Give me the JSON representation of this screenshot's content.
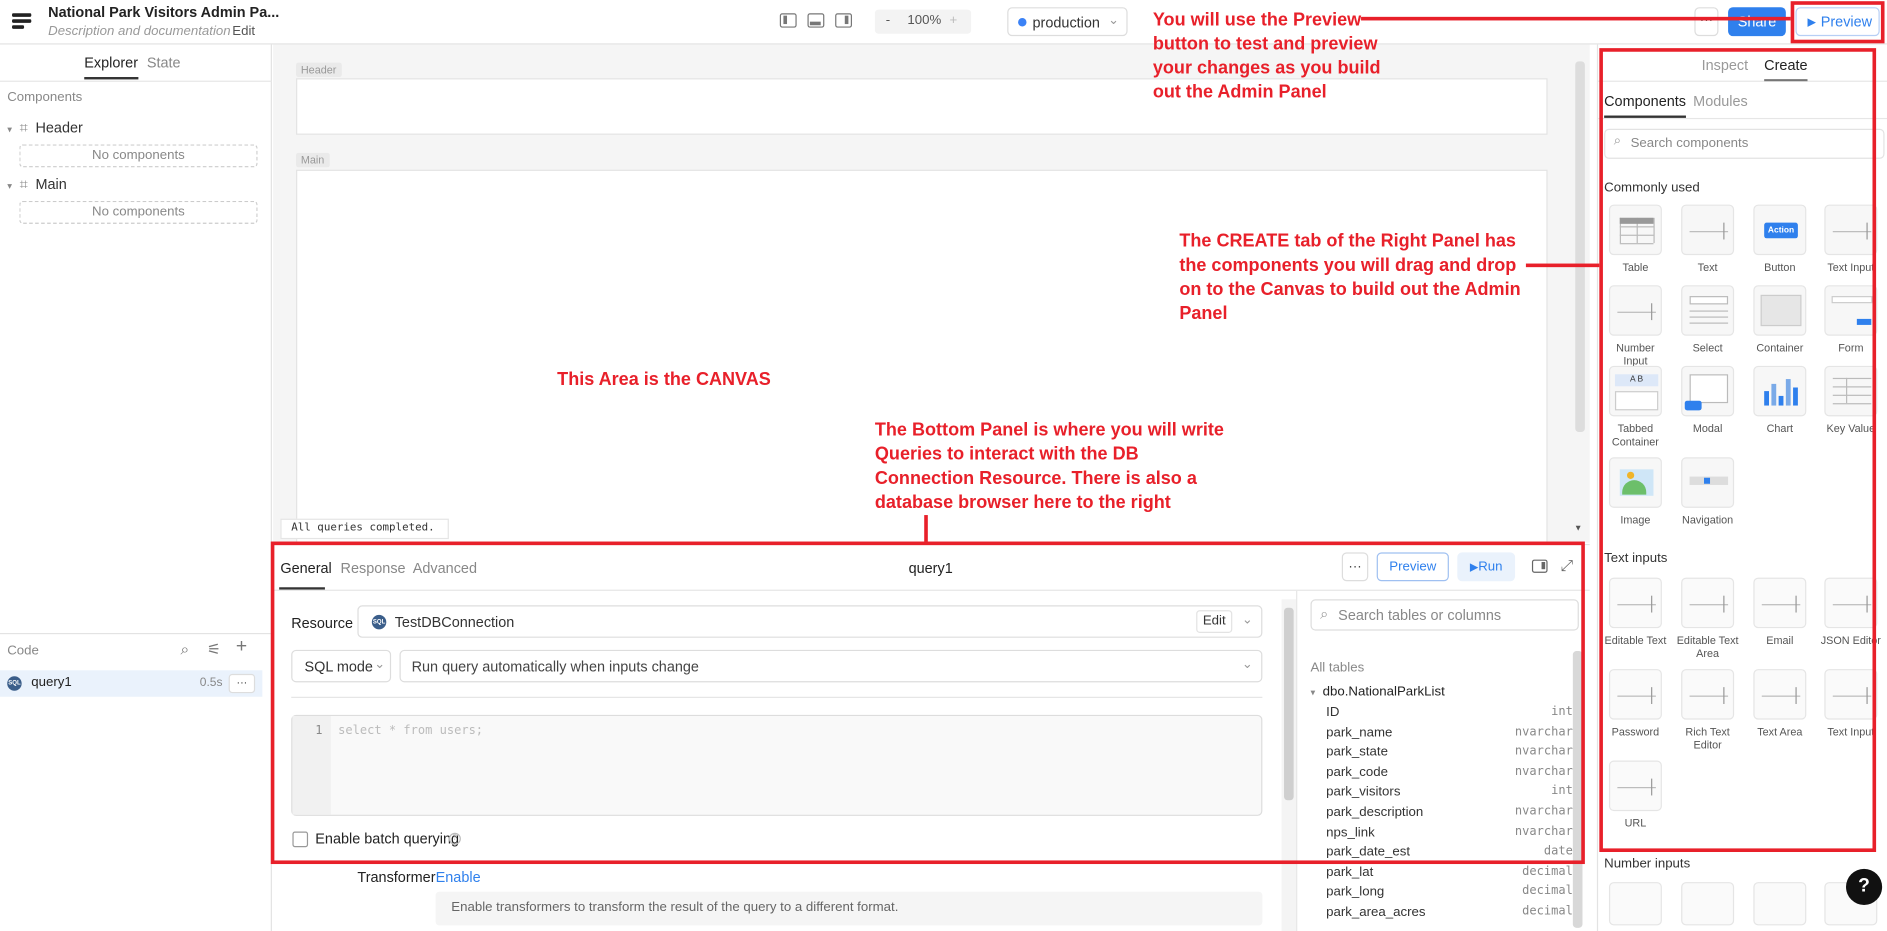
{
  "header": {
    "app_title": "National Park Visitors Admin Pa...",
    "app_description": "Description and documentation",
    "edit_label": "Edit",
    "zoom_minus": "-",
    "zoom_value": "100%",
    "zoom_plus": "+",
    "environment": "production",
    "more": "···",
    "share": "Share",
    "preview": "Preview"
  },
  "left_panel": {
    "tabs": [
      "Explorer",
      "State"
    ],
    "components_label": "Components",
    "tree": [
      {
        "label": "Header",
        "empty": "No components"
      },
      {
        "label": "Main",
        "empty": "No components"
      }
    ],
    "code_label": "Code",
    "queries": [
      {
        "name": "query1",
        "sql_badge": "SQL",
        "time": "0.5s",
        "more": "···"
      }
    ]
  },
  "canvas": {
    "header_label": "Header",
    "main_label": "Main",
    "status": "All queries completed."
  },
  "bottom_panel": {
    "tabs": [
      "General",
      "Response",
      "Advanced"
    ],
    "query_name": "query1",
    "more": "···",
    "preview": "Preview",
    "run": "Run",
    "resource_label": "Resource",
    "resource_value": "TestDBConnection",
    "resource_edit": "Edit",
    "sql_mode": "SQL mode",
    "run_mode": "Run query automatically when inputs change",
    "line_number": "1",
    "editor_placeholder": "select * from users;",
    "batch_label": "Enable batch querying",
    "transformer_label": "Transformer",
    "transformer_enable": "Enable",
    "transformer_note": "Enable transformers to transform the result of the query to a different format.",
    "db_search_placeholder": "Search tables or columns",
    "all_tables": "All tables",
    "table_name": "dbo.NationalParkList",
    "columns": [
      {
        "name": "ID",
        "type": "int"
      },
      {
        "name": "park_name",
        "type": "nvarchar"
      },
      {
        "name": "park_state",
        "type": "nvarchar"
      },
      {
        "name": "park_code",
        "type": "nvarchar"
      },
      {
        "name": "park_visitors",
        "type": "int"
      },
      {
        "name": "park_description",
        "type": "nvarchar"
      },
      {
        "name": "nps_link",
        "type": "nvarchar"
      },
      {
        "name": "park_date_est",
        "type": "date"
      },
      {
        "name": "park_lat",
        "type": "decimal"
      },
      {
        "name": "park_long",
        "type": "decimal"
      },
      {
        "name": "park_area_acres",
        "type": "decimal"
      }
    ]
  },
  "right_panel": {
    "tabs": [
      "Inspect",
      "Create"
    ],
    "subtabs": [
      "Components",
      "Modules"
    ],
    "search_placeholder": "Search components",
    "commonly_used_label": "Commonly used",
    "commonly_used": [
      "Table",
      "Text",
      "Button",
      "Text Input",
      "Number Input",
      "Select",
      "Container",
      "Form",
      "Tabbed Container",
      "Modal",
      "Chart",
      "Key Value",
      "Image",
      "Navigation"
    ],
    "button_icon_text": "Action",
    "tabbed_icon_text": "A  B",
    "text_inputs_label": "Text inputs",
    "text_inputs": [
      "Editable Text",
      "Editable Text Area",
      "Email",
      "JSON Editor",
      "Password",
      "Rich Text Editor",
      "Text Area",
      "Text Input",
      "URL"
    ],
    "number_inputs_label": "Number inputs",
    "help": "?"
  },
  "annotations": {
    "preview_note": "You will use the Preview button to test and preview your changes as you build out the Admin Panel",
    "create_note": "The CREATE tab of the Right Panel has the components you will drag and drop on to the Canvas to build out the Admin Panel",
    "canvas_note": "This Area is the CANVAS",
    "bottom_note": "The Bottom Panel is where you will write Queries to interact with the DB Connection Resource. There is also a database browser here to the right",
    "color": "#e8202a"
  }
}
